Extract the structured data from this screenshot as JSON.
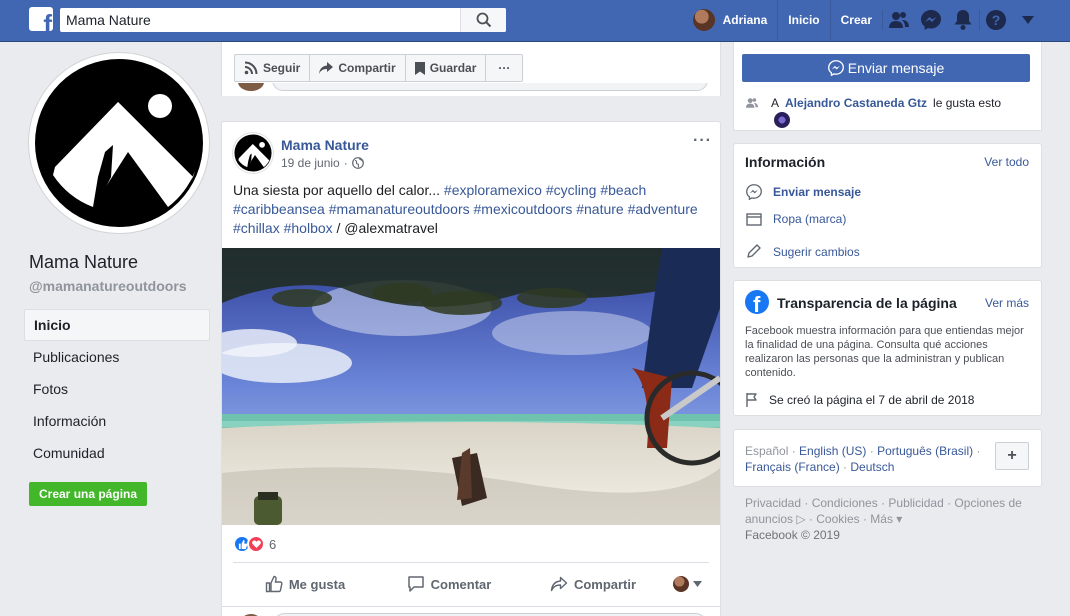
{
  "topbar": {
    "logo": "f",
    "search_value": "Mama Nature",
    "user_name": "Adriana",
    "home_label": "Inicio",
    "create_label": "Crear",
    "icons": [
      "friends-icon",
      "messenger-icon",
      "notifications-icon",
      "help-icon",
      "menu-caret-icon"
    ]
  },
  "profile": {
    "name": "Mama Nature",
    "handle": "@mamanatureoutdoors"
  },
  "left_nav": {
    "items": [
      {
        "label": "Inicio",
        "active": true
      },
      {
        "label": "Publicaciones"
      },
      {
        "label": "Fotos"
      },
      {
        "label": "Información"
      },
      {
        "label": "Comunidad"
      }
    ],
    "create_page_label": "Crear una página"
  },
  "action_bar": {
    "follow_label": "Seguir",
    "share_label": "Compartir",
    "save_label": "Guardar",
    "more_label": "···"
  },
  "post": {
    "author": "Mama Nature",
    "date": "19 de junio",
    "separator": "·",
    "text_plain": "Una siesta por aquello del calor... ",
    "hashtags": [
      "#exploramexico",
      "#cycling",
      "#beach",
      "#caribbeansea",
      "#mamanatureoutdoors",
      "#mexicoutdoors",
      "#nature",
      "#adventure",
      "#chillax",
      "#holbox"
    ],
    "credit": " / @alexmatravel",
    "reaction_count": "6",
    "like_label": "Me gusta",
    "comment_label": "Comentar",
    "share_label": "Compartir"
  },
  "right": {
    "send_message_label": "Enviar mensaje",
    "liked_prefix": "A",
    "liked_name": "Alejandro Castaneda Gtz",
    "liked_suffix": "le gusta esto",
    "info_title": "Información",
    "info_see_all": "Ver todo",
    "info_rows": [
      {
        "label": "Enviar mensaje",
        "icon": "messenger-icon",
        "bold": true
      },
      {
        "label": "Ropa (marca)",
        "icon": "category-icon"
      },
      {
        "label": "Sugerir cambios",
        "icon": "pencil-icon"
      }
    ],
    "transparency_title": "Transparencia de la página",
    "transparency_more": "Ver más",
    "transparency_body": "Facebook muestra información para que entiendas mejor la finalidad de una página. Consulta qué acciones realizaron las personas que la administran y publican contenido.",
    "transparency_created": "Se creó la página el 7 de abril de 2018",
    "languages": {
      "current": "Español",
      "others": [
        "English (US)",
        "Português (Brasil)",
        "Français (France)",
        "Deutsch"
      ],
      "add_label": "+"
    },
    "footer": {
      "links": "Privacidad · Condiciones · Publicidad · Opciones de anuncios ▷ · Cookies · Más ▾",
      "copyright": "Facebook © 2019"
    }
  },
  "colors": {
    "brand_blue": "#4267b2",
    "link_blue": "#385898",
    "green_button": "#42b72a",
    "background": "#e9ebee"
  }
}
